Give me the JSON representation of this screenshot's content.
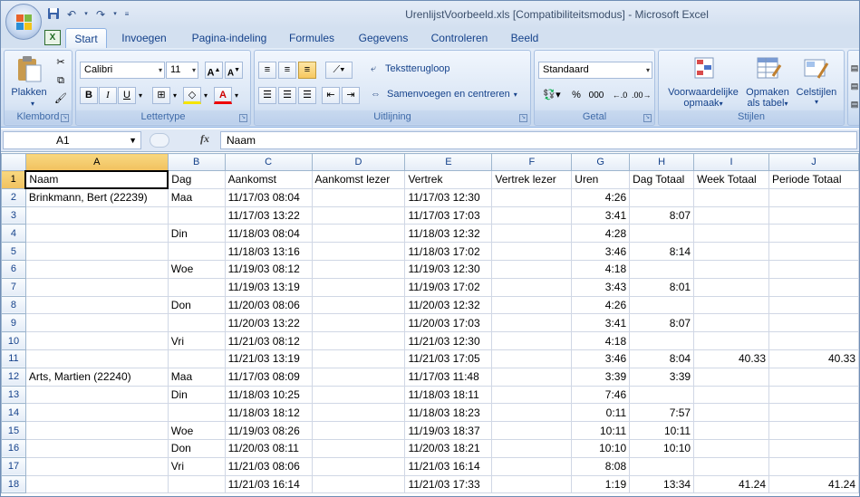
{
  "window": {
    "title": "UrenlijstVoorbeeld.xls  [Compatibiliteitsmodus] - Microsoft Excel"
  },
  "tabs": [
    "Start",
    "Invoegen",
    "Pagina-indeling",
    "Formules",
    "Gegevens",
    "Controleren",
    "Beeld"
  ],
  "ribbon": {
    "klembord": {
      "label": "Klembord",
      "paste_label": "Plakken"
    },
    "lettertype": {
      "label": "Lettertype",
      "font": "Calibri",
      "size": "11"
    },
    "uitlijning": {
      "label": "Uitlijning",
      "wrap": "Tekstterugloop",
      "merge": "Samenvoegen en centreren"
    },
    "getal": {
      "label": "Getal",
      "format": "Standaard",
      "percent": "%",
      "thousands": "000"
    },
    "stijlen": {
      "label": "Stijlen",
      "cond": "Voorwaardelijke",
      "cond2": "opmaak",
      "table": "Opmaken",
      "table2": "als tabel",
      "cell": "Celstijlen"
    }
  },
  "formula_bar": {
    "cell_ref": "A1",
    "fx": "fx",
    "content": "Naam"
  },
  "columns": [
    "A",
    "B",
    "C",
    "D",
    "E",
    "F",
    "G",
    "H",
    "I",
    "J"
  ],
  "rows": [
    [
      "Naam",
      "Dag",
      "Aankomst",
      "Aankomst lezer",
      "Vertrek",
      "Vertrek lezer",
      "Uren",
      "Dag Totaal",
      "Week Totaal",
      "Periode Totaal"
    ],
    [
      "Brinkmann, Bert (22239)",
      "Maa",
      "11/17/03 08:04",
      "",
      "11/17/03 12:30",
      "",
      "4:26",
      "",
      "",
      ""
    ],
    [
      "",
      "",
      "11/17/03 13:22",
      "",
      "11/17/03 17:03",
      "",
      "3:41",
      "8:07",
      "",
      ""
    ],
    [
      "",
      "Din",
      "11/18/03 08:04",
      "",
      "11/18/03 12:32",
      "",
      "4:28",
      "",
      "",
      ""
    ],
    [
      "",
      "",
      "11/18/03 13:16",
      "",
      "11/18/03 17:02",
      "",
      "3:46",
      "8:14",
      "",
      ""
    ],
    [
      "",
      "Woe",
      "11/19/03 08:12",
      "",
      "11/19/03 12:30",
      "",
      "4:18",
      "",
      "",
      ""
    ],
    [
      "",
      "",
      "11/19/03 13:19",
      "",
      "11/19/03 17:02",
      "",
      "3:43",
      "8:01",
      "",
      ""
    ],
    [
      "",
      "Don",
      "11/20/03 08:06",
      "",
      "11/20/03 12:32",
      "",
      "4:26",
      "",
      "",
      ""
    ],
    [
      "",
      "",
      "11/20/03 13:22",
      "",
      "11/20/03 17:03",
      "",
      "3:41",
      "8:07",
      "",
      ""
    ],
    [
      "",
      "Vri",
      "11/21/03 08:12",
      "",
      "11/21/03 12:30",
      "",
      "4:18",
      "",
      "",
      ""
    ],
    [
      "",
      "",
      "11/21/03 13:19",
      "",
      "11/21/03 17:05",
      "",
      "3:46",
      "8:04",
      "40.33",
      "40.33"
    ],
    [
      "Arts, Martien (22240)",
      "Maa",
      "11/17/03 08:09",
      "",
      "11/17/03 11:48",
      "",
      "3:39",
      "3:39",
      "",
      ""
    ],
    [
      "",
      "Din",
      "11/18/03 10:25",
      "",
      "11/18/03 18:11",
      "",
      "7:46",
      "",
      "",
      ""
    ],
    [
      "",
      "",
      "11/18/03 18:12",
      "",
      "11/18/03 18:23",
      "",
      "0:11",
      "7:57",
      "",
      ""
    ],
    [
      "",
      "Woe",
      "11/19/03 08:26",
      "",
      "11/19/03 18:37",
      "",
      "10:11",
      "10:11",
      "",
      ""
    ],
    [
      "",
      "Don",
      "11/20/03 08:11",
      "",
      "11/20/03 18:21",
      "",
      "10:10",
      "10:10",
      "",
      ""
    ],
    [
      "",
      "Vri",
      "11/21/03 08:06",
      "",
      "11/21/03 16:14",
      "",
      "8:08",
      "",
      "",
      ""
    ],
    [
      "",
      "",
      "11/21/03 16:14",
      "",
      "11/21/03 17:33",
      "",
      "1:19",
      "13:34",
      "41.24",
      "41.24"
    ]
  ]
}
